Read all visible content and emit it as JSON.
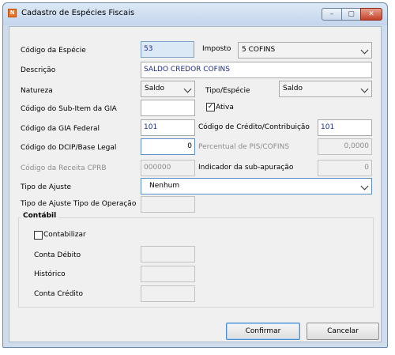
{
  "window": {
    "title": "Cadastro de Espécies Fiscais",
    "icon": "app-icon",
    "controls": {
      "minimize": "–",
      "maximize": "▢",
      "close": "✕"
    }
  },
  "form": {
    "codigo_especie": {
      "label": "Código da Espécie",
      "value": "53"
    },
    "imposto": {
      "label": "Imposto",
      "value": "5 COFINS"
    },
    "descricao": {
      "label": "Descrição",
      "value": "SALDO CREDOR COFINS"
    },
    "natureza": {
      "label": "Natureza",
      "value": "Saldo"
    },
    "tipo_especie": {
      "label": "Tipo/Espécie",
      "value": "Saldo"
    },
    "sub_item_gia": {
      "label": "Código do Sub-Item da GIA",
      "value": ""
    },
    "ativa": {
      "label": "Ativa",
      "checked": true
    },
    "gia_federal": {
      "label": "Código da GIA Federal",
      "value": "101"
    },
    "credito_contribuicao": {
      "label": "Código de Crédito/Contribuição",
      "value": "101"
    },
    "dcip": {
      "label": "Código do DCIP/Base Legal",
      "value": "0"
    },
    "percentual": {
      "label": "Percentual de PIS/COFINS",
      "value": "0,0000"
    },
    "receita_cprb": {
      "label": "Código da Receita CPRB",
      "value": "000000"
    },
    "sub_apuracao": {
      "label": "Indicador da sub-apuração",
      "value": "0"
    },
    "tipo_ajuste": {
      "label": "Tipo de Ajuste",
      "value": "Nenhum"
    },
    "tipo_ajuste_operacao": {
      "label": "Tipo de Ajuste Tipo de Operação",
      "value": ""
    }
  },
  "contabil": {
    "title": "Contábil",
    "contabilizar": {
      "label": "Contabilizar",
      "checked": false
    },
    "conta_debito": {
      "label": "Conta Débito",
      "value": ""
    },
    "historico": {
      "label": "Histórico",
      "value": ""
    },
    "conta_credito": {
      "label": "Conta Crédito",
      "value": ""
    }
  },
  "buttons": {
    "confirm": "Confirmar",
    "cancel": "Cancelar"
  }
}
